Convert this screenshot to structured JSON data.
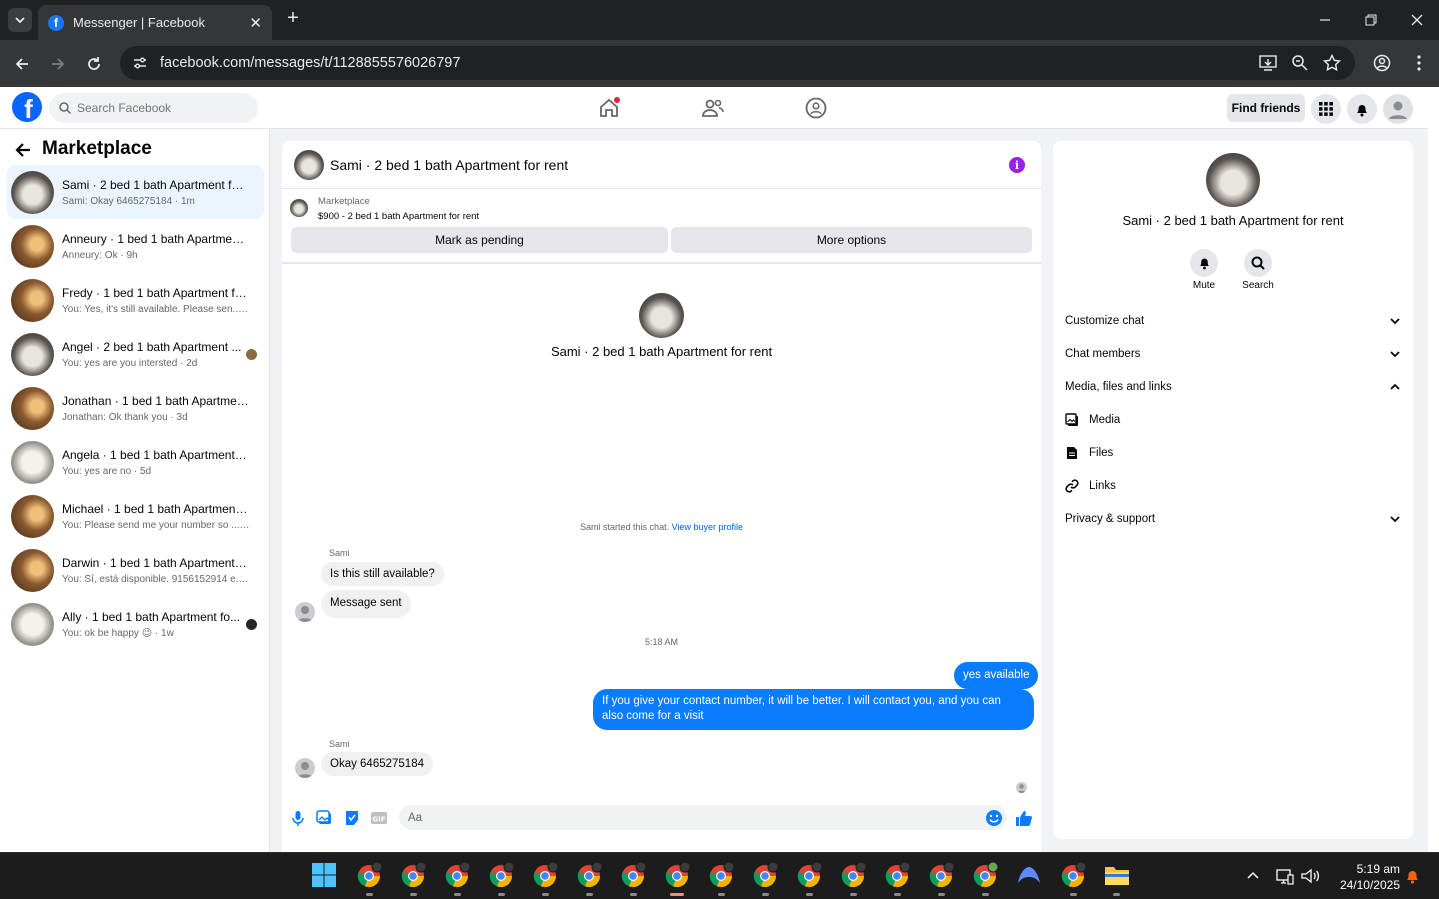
{
  "browser": {
    "tab_title": "Messenger | Facebook",
    "url": "facebook.com/messages/t/1128855576026797"
  },
  "fb": {
    "search_placeholder": "Search Facebook",
    "find_friends": "Find friends",
    "brand_color": "#0866ff"
  },
  "sidebar": {
    "title": "Marketplace",
    "chats": [
      {
        "name": "Sami · 2 bed 1 bath Apartment for ...",
        "preview": "Sami: Okay 6465275184 · 1m",
        "active": true
      },
      {
        "name": "Anneury · 1 bed 1 bath Apartment ...",
        "preview": "Anneury: Ok · 9h"
      },
      {
        "name": "Fredy · 1 bed 1 bath Apartment for...",
        "preview": "You: Yes, it's still available. Please sen... · 10h"
      },
      {
        "name": "Angel · 2 bed 1 bath Apartment ...",
        "preview": "You: yes are you intersted · 2d"
      },
      {
        "name": "Jonathan · 1 bed 1 bath Apartment...",
        "preview": "Jonathan: Ok thank you · 3d"
      },
      {
        "name": "Angela · 1 bed 1 bath Apartment f...",
        "preview": "You: yes are no · 5d"
      },
      {
        "name": "Michael · 1 bed 1 bath Apartment f...",
        "preview": "You: Please send me your number so ... · 1w"
      },
      {
        "name": "Darwin · 1 bed 1 bath Apartment f...",
        "preview": "You: Sí, está disponible. 9156152914 e... · 1w"
      },
      {
        "name": "Ally · 1 bed 1 bath Apartment fo...",
        "preview": "You: ok be happy 😉 · 1w"
      }
    ]
  },
  "chat": {
    "title": "Sami · 2 bed 1 bath Apartment for rent",
    "listing_source": "Marketplace",
    "listing_title": "$900 - 2 bed 1 bath Apartment for rent",
    "mark_pending": "Mark as pending",
    "more_options": "More options",
    "started_text": "Sami started this chat.",
    "view_buyer": "View buyer profile",
    "sender_name": "Sami",
    "msg1": "Is this still available?",
    "msg2": "Message sent",
    "time": "5:18 AM",
    "out1": "yes available",
    "out2": "If you give your contact number, it will be better. I will contact you, and you can also come for a visit",
    "sender_name2": "Sami",
    "msg3": "Okay 6465275184",
    "composer_placeholder": "Aa",
    "accent": "#0a7cff"
  },
  "details": {
    "name": "Sami · 2 bed 1 bath Apartment for rent",
    "mute": "Mute",
    "search": "Search",
    "customize": "Customize chat",
    "members": "Chat members",
    "media_section": "Media, files and links",
    "media": "Media",
    "files": "Files",
    "links": "Links",
    "privacy": "Privacy & support"
  },
  "taskbar": {
    "time": "5:19 am",
    "date": "24/10/2025"
  }
}
